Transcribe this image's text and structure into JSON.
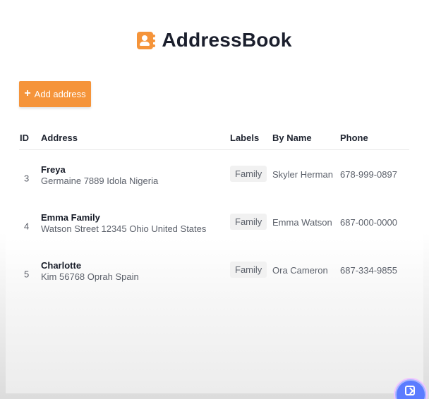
{
  "header": {
    "title": "AddressBook",
    "icon": "address-book-icon"
  },
  "toolbar": {
    "add_label": "Add address",
    "add_icon": "plus-icon"
  },
  "table": {
    "columns": [
      "ID",
      "Address",
      "Labels",
      "By Name",
      "Phone"
    ],
    "rows": [
      {
        "id": "3",
        "name": "Freya",
        "address": "Germaine 7889 Idola Nigeria",
        "label": "Family",
        "by_name": "Skyler Herman",
        "phone": "678-999-0897"
      },
      {
        "id": "4",
        "name": "Emma Family",
        "address": "Watson Street 12345 Ohio United States",
        "label": "Family",
        "by_name": "Emma Watson",
        "phone": "687-000-0000"
      },
      {
        "id": "5",
        "name": "Charlotte",
        "address": "Kim 56768 Oprah Spain",
        "label": "Family",
        "by_name": "Ora Cameron",
        "phone": "687-334-9855"
      }
    ]
  },
  "colors": {
    "accent": "#f5943a",
    "text": "#1f2430",
    "muted_text": "#5c616b",
    "pill_bg": "#f1f1f1"
  },
  "floating_action": {
    "icon": "assistant-icon"
  }
}
